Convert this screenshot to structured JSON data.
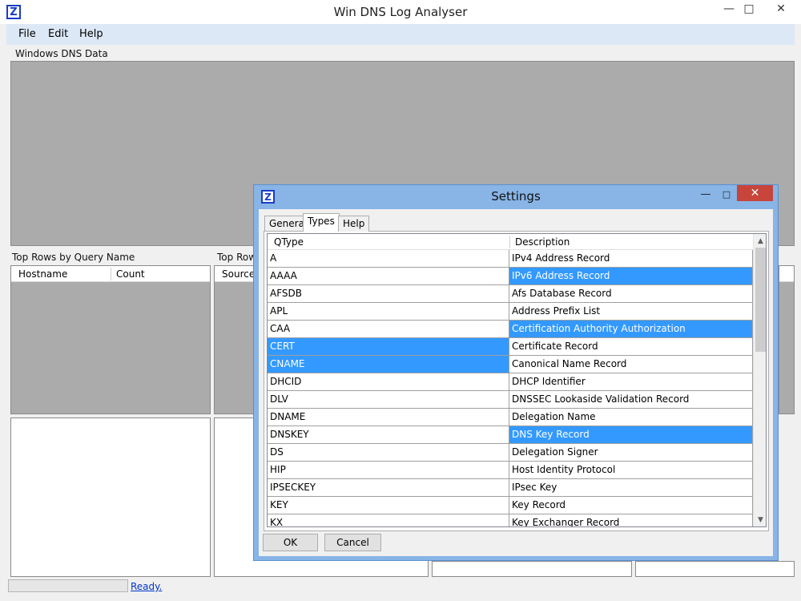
{
  "window": {
    "title": "Win DNS Log Analyser",
    "icon_letter": "Z",
    "minimize": "—",
    "maximize": "□",
    "close": "✕"
  },
  "menu": [
    "File",
    "Edit",
    "Help"
  ],
  "main": {
    "windows_dns_label": "Windows DNS Data",
    "top_query_label": "Top Rows by Query Name",
    "top_rows_label": "Top Rows",
    "hostname_col": "Hostname",
    "count_col": "Count",
    "source_col": "Source I"
  },
  "status": {
    "text": "Ready."
  },
  "dialog": {
    "title": "Settings",
    "icon_letter": "Z",
    "minimize": "—",
    "maximize": "□",
    "close": "✕",
    "tabs": [
      "General",
      "Types",
      "Help"
    ],
    "active_tab": "Types",
    "columns": [
      "QType",
      "Description"
    ],
    "rows": [
      {
        "qtype": "A",
        "desc": "IPv4 Address Record",
        "sel_q": false,
        "sel_d": false
      },
      {
        "qtype": "AAAA",
        "desc": "IPv6 Address Record",
        "sel_q": false,
        "sel_d": true
      },
      {
        "qtype": "AFSDB",
        "desc": "Afs Database Record",
        "sel_q": false,
        "sel_d": false
      },
      {
        "qtype": "APL",
        "desc": "Address Prefix List",
        "sel_q": false,
        "sel_d": false
      },
      {
        "qtype": "CAA",
        "desc": "Certification Authority Authorization",
        "sel_q": false,
        "sel_d": true
      },
      {
        "qtype": "CERT",
        "desc": "Certificate Record",
        "sel_q": true,
        "sel_d": false
      },
      {
        "qtype": "CNAME",
        "desc": "Canonical Name Record",
        "sel_q": true,
        "sel_d": false
      },
      {
        "qtype": "DHCID",
        "desc": "DHCP Identifier",
        "sel_q": false,
        "sel_d": false
      },
      {
        "qtype": "DLV",
        "desc": "DNSSEC Lookaside Validation Record",
        "sel_q": false,
        "sel_d": false
      },
      {
        "qtype": "DNAME",
        "desc": "Delegation Name",
        "sel_q": false,
        "sel_d": false
      },
      {
        "qtype": "DNSKEY",
        "desc": "DNS Key Record",
        "sel_q": false,
        "sel_d": true
      },
      {
        "qtype": "DS",
        "desc": "Delegation Signer",
        "sel_q": false,
        "sel_d": false
      },
      {
        "qtype": "HIP",
        "desc": "Host Identity Protocol",
        "sel_q": false,
        "sel_d": false
      },
      {
        "qtype": "IPSECKEY",
        "desc": "IPsec Key",
        "sel_q": false,
        "sel_d": false
      },
      {
        "qtype": "KEY",
        "desc": "Key Record",
        "sel_q": false,
        "sel_d": false
      },
      {
        "qtype": "KX",
        "desc": "Key Exchanger Record",
        "sel_q": false,
        "sel_d": false
      }
    ],
    "ok_label": "OK",
    "cancel_label": "Cancel"
  },
  "colors": {
    "selection": "#3399ff",
    "dialog_frame": "#88b4e6",
    "close_button": "#c7453b",
    "menubar": "#dde8f6"
  }
}
